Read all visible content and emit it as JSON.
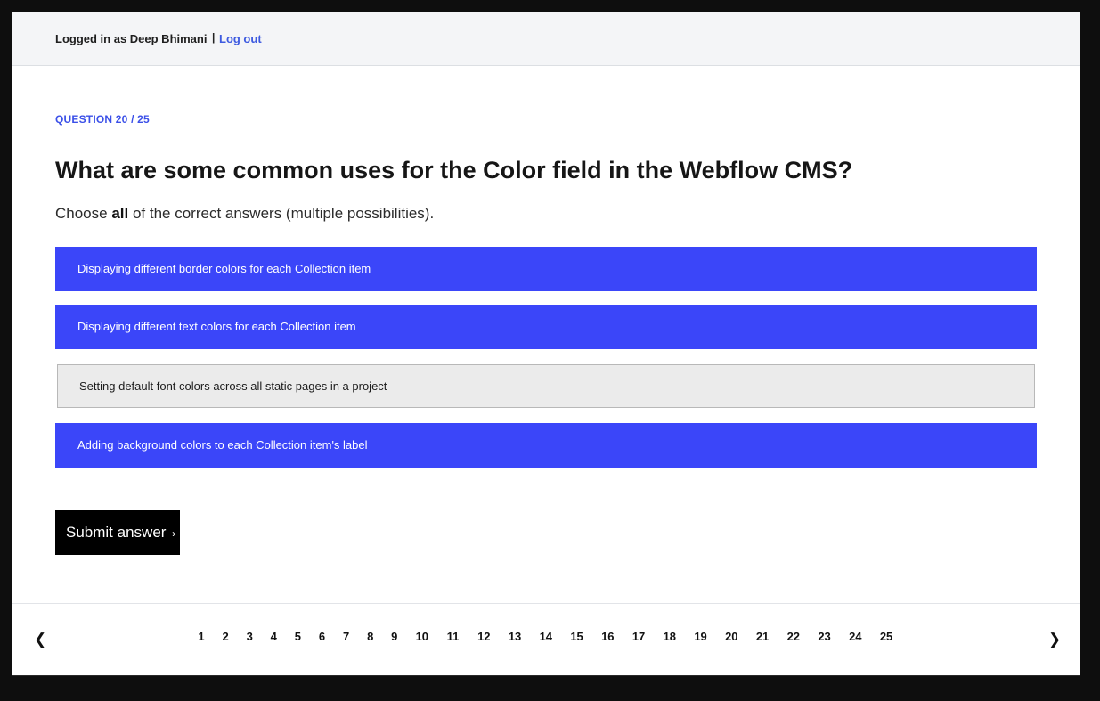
{
  "header": {
    "logged_in_text": "Logged in as Deep Bhimani",
    "separator": "|",
    "logout_label": "Log out"
  },
  "quiz": {
    "progress_label": "QUESTION 20 / 25",
    "question": "What are some common uses for the Color field in the Webflow CMS?",
    "instruction_pre": "Choose ",
    "instruction_bold": "all",
    "instruction_post": " of the correct answers (multiple possibilities).",
    "options": [
      {
        "label": "Displaying different border colors for each Collection item",
        "selected": true
      },
      {
        "label": "Displaying different text colors for each Collection item",
        "selected": true
      },
      {
        "label": "Setting default font colors across all static pages in a project",
        "selected": false
      },
      {
        "label": "Adding background colors to each Collection item's label",
        "selected": true
      }
    ],
    "submit_label": "Submit answer",
    "submit_chevron": "›"
  },
  "pagination": {
    "prev_icon": "❮",
    "next_icon": "❯",
    "pages": [
      "1",
      "2",
      "3",
      "4",
      "5",
      "6",
      "7",
      "8",
      "9",
      "10",
      "11",
      "12",
      "13",
      "14",
      "15",
      "16",
      "17",
      "18",
      "19",
      "20",
      "21",
      "22",
      "23",
      "24",
      "25"
    ]
  },
  "colors": {
    "accent": "#3b46f9",
    "link": "#3d5ae0",
    "unselected_bg": "#ebebeb",
    "button_bg": "#000000"
  }
}
